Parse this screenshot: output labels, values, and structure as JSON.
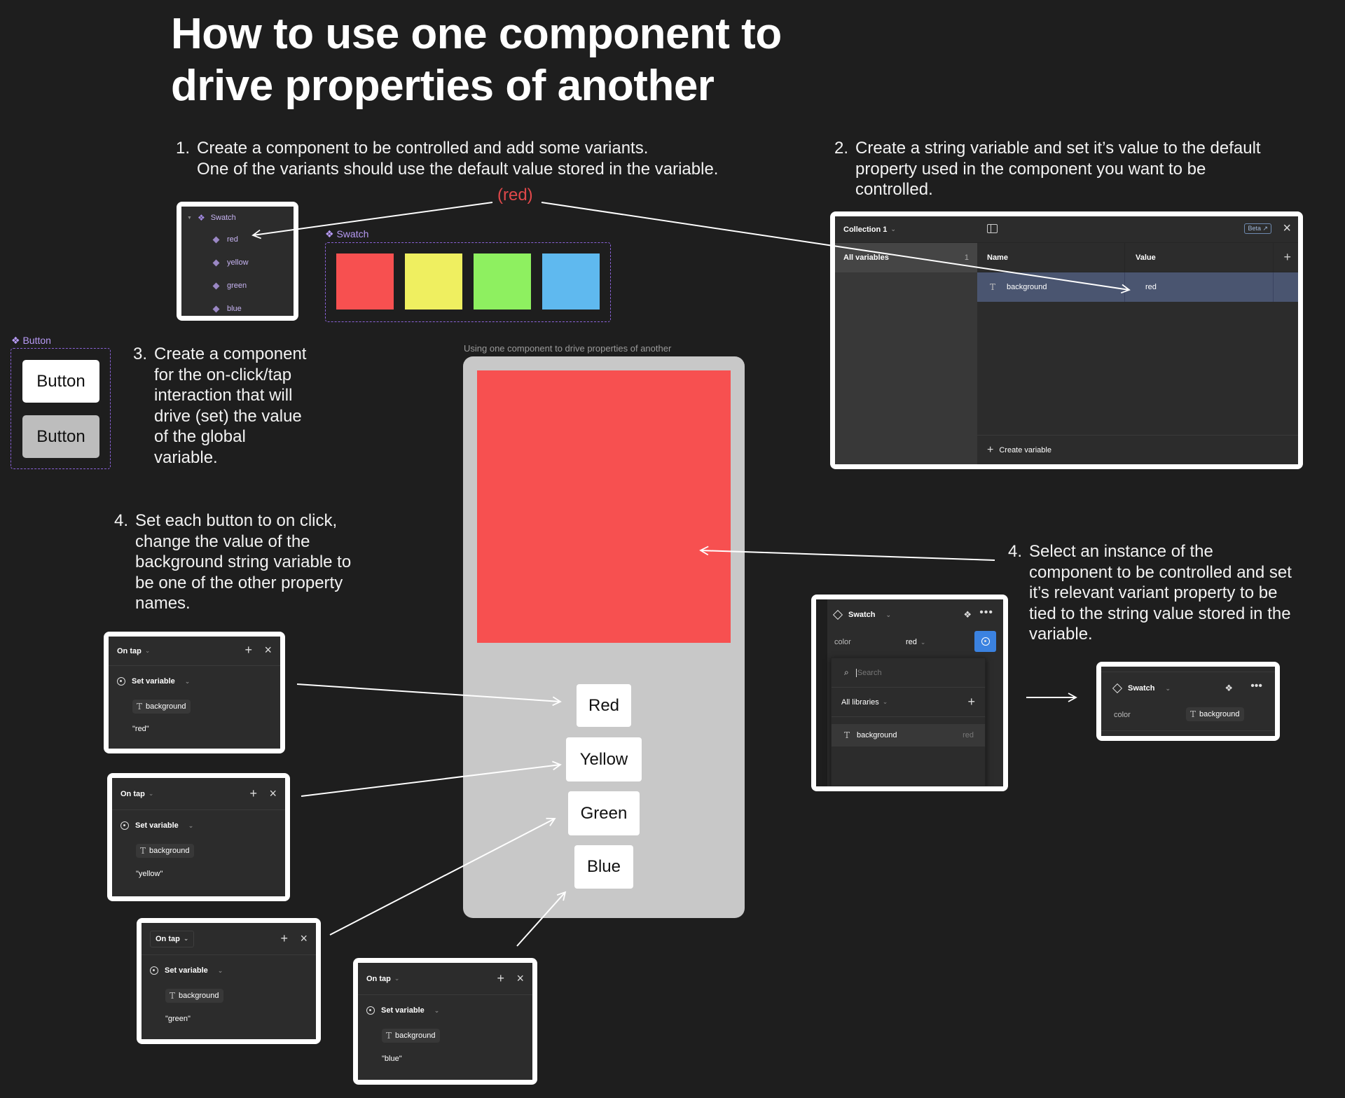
{
  "title": {
    "line1": "How to use one component to",
    "line2": "drive properties of another"
  },
  "steps": {
    "step1": {
      "num": "1.",
      "lines": [
        "Create a component to be controlled and add some variants.",
        "One of the variants should use the default value stored in the variable."
      ]
    },
    "step2": {
      "num": "2.",
      "lines": [
        "Create a string variable and set it’s value to the default",
        "property used in the component you want to be",
        "controlled."
      ]
    },
    "step3": {
      "num": "3.",
      "lines": [
        "Create a component",
        "for the on-click/tap",
        "interaction that will",
        "drive (set) the value",
        "of the global",
        "variable."
      ]
    },
    "step4_left": {
      "num": "4.",
      "lines": [
        "Set each button to on click,",
        "change the value of the",
        "background string variable to",
        "be one of the other property",
        "names."
      ]
    },
    "step4_right": {
      "num": "4.",
      "lines": [
        "Select an instance of the",
        "component to be controlled and set",
        "it’s relevant variant property to be",
        "tied to the string value stored in the",
        "variable."
      ]
    }
  },
  "default_note": "(red)",
  "layers_panel": {
    "component": "Swatch",
    "variants": [
      "red",
      "yellow",
      "green",
      "blue"
    ]
  },
  "swatch_component": {
    "label": "Swatch",
    "colors": [
      "#f75050",
      "#efef60",
      "#8ef060",
      "#5fb9ef"
    ]
  },
  "button_component": {
    "label": "Button",
    "default_label": "Button",
    "pressed_label": "Button"
  },
  "variables_panel": {
    "collection": "Collection 1",
    "beta_badge": "Beta",
    "group": "All variables",
    "group_count": "1",
    "col_name": "Name",
    "col_value": "Value",
    "rows": [
      {
        "name": "background",
        "value": "red"
      }
    ],
    "create_label": "Create variable"
  },
  "prototype": {
    "frame_label": "Using one component to drive properties of another",
    "swatch_color": "#f75050",
    "buttons": [
      "Red",
      "Yellow",
      "Green",
      "Blue"
    ]
  },
  "interactions": [
    {
      "trigger": "On tap",
      "action": "Set variable",
      "variable": "background",
      "value": "\"red\""
    },
    {
      "trigger": "On tap",
      "action": "Set variable",
      "variable": "background",
      "value": "\"yellow\""
    },
    {
      "trigger": "On tap",
      "action": "Set variable",
      "variable": "background",
      "value": "\"green\""
    },
    {
      "trigger": "On tap",
      "action": "Set variable",
      "variable": "background",
      "value": "\"blue\""
    }
  ],
  "instance_panel": {
    "component": "Swatch",
    "prop_label": "color",
    "prop_value": "red",
    "search_placeholder": "Search",
    "libraries": "All libraries",
    "var_name": "background",
    "var_value": "red"
  },
  "bound_panel": {
    "component": "Swatch",
    "prop_label": "color",
    "bound_var": "background"
  }
}
